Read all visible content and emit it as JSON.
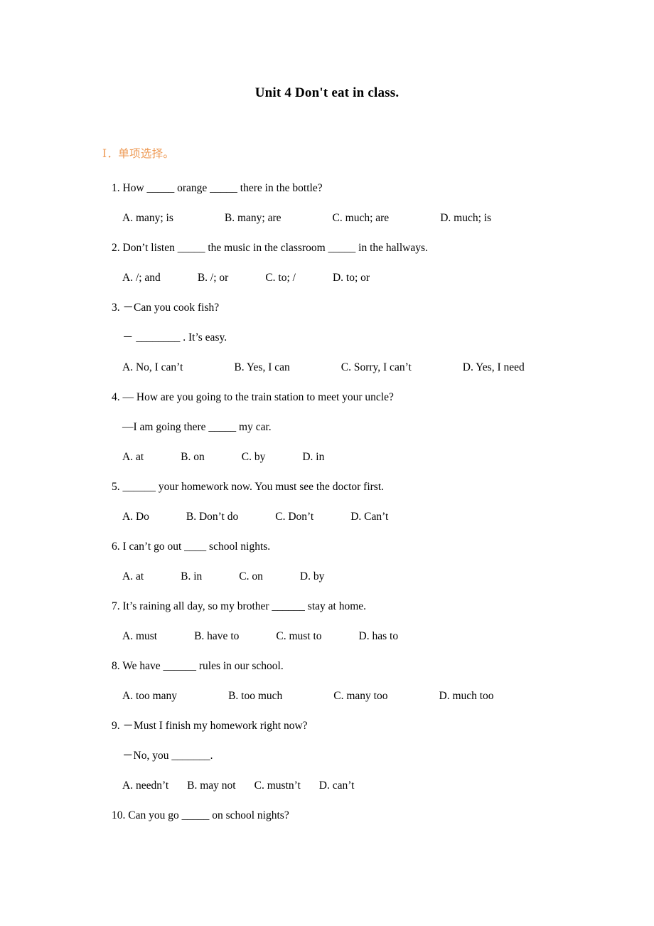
{
  "document": {
    "title": "Unit 4 Don't eat in class.",
    "section_heading": "Ⅰ．单项选择。",
    "heading_color": "#EE9A55"
  },
  "questions": [
    {
      "number": "1.",
      "stem": "1. How _____ orange _____ there in the bottle?",
      "sub": null,
      "options": [
        "A. many; is",
        "B. many; are",
        "C. much; are",
        "D. much; is"
      ],
      "option_gap": "wide"
    },
    {
      "number": "2.",
      "stem": "2. Don’t listen _____ the music in the classroom _____ in the hallways.",
      "sub": null,
      "options": [
        "A. /; and",
        "B. /; or",
        "C. to; /",
        "D. to; or"
      ],
      "option_gap": "med"
    },
    {
      "number": "3.",
      "stem": "3.  －Can you cook fish?",
      "sub": "－ ________ . It’s easy.",
      "options": [
        "A. No, I can’t",
        "B. Yes, I can",
        "C. Sorry, I can’t",
        "D. Yes, I need"
      ],
      "option_gap": "wide"
    },
    {
      "number": "4.",
      "stem": "4. — How are you going to the train station to meet your uncle?",
      "sub": "—I am going there _____ my car.",
      "options": [
        "A. at",
        "B. on",
        "C. by",
        "D. in"
      ],
      "option_gap": "med"
    },
    {
      "number": "5.",
      "stem": "5. ______ your homework now. You must see the doctor first.",
      "sub": null,
      "options": [
        "A. Do",
        "B. Don’t do",
        "C. Don’t",
        "D. Can’t"
      ],
      "option_gap": "med"
    },
    {
      "number": "6.",
      "stem": "6. I can’t go out ____ school nights.",
      "sub": null,
      "options": [
        "A. at",
        "B. in",
        "C. on",
        "D. by"
      ],
      "option_gap": "med"
    },
    {
      "number": "7.",
      "stem": "7. It’s raining all day, so my brother ______ stay at home.",
      "sub": null,
      "options": [
        "A. must",
        "B. have to",
        "C. must to",
        "D. has to"
      ],
      "option_gap": "med"
    },
    {
      "number": "8.",
      "stem": "8. We have ______ rules in our school.",
      "sub": null,
      "options": [
        "A. too many",
        "B. too much",
        "C. many too",
        "D. much too"
      ],
      "option_gap": "wide"
    },
    {
      "number": "9.",
      "stem": "9.  －Must I finish my homework right now?",
      "sub": "－No, you _______.",
      "options": [
        "A. needn’t",
        "B. may not",
        "C. mustn’t",
        "D. can’t"
      ],
      "option_gap": "small"
    },
    {
      "number": "10.",
      "stem": "10. Can you go _____ on school nights?",
      "sub": null,
      "options": [],
      "option_gap": "med"
    }
  ]
}
